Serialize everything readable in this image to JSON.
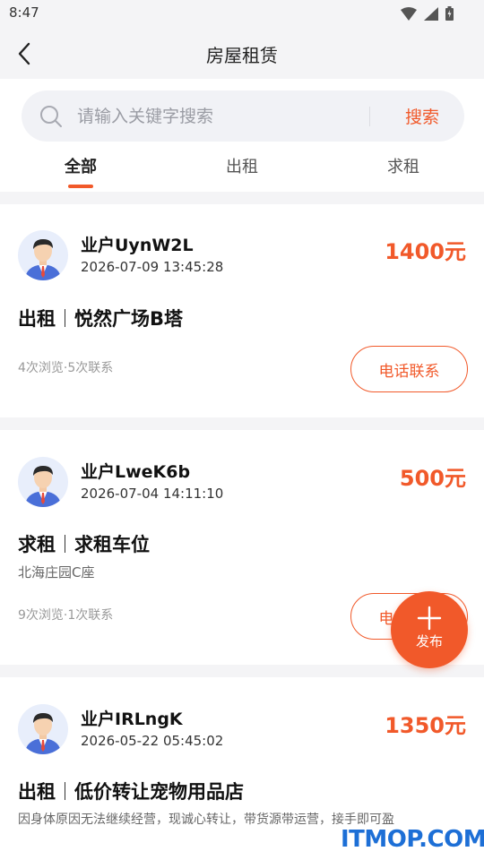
{
  "status_bar": {
    "time": "8:47",
    "icons": [
      "wifi-icon",
      "signal-icon",
      "battery-icon"
    ]
  },
  "header": {
    "title": "房屋租赁",
    "back_icon": "chevron-left-icon"
  },
  "search": {
    "placeholder": "请输入关键字搜索",
    "value": "",
    "button_label": "搜索",
    "icon": "search-icon"
  },
  "tabs": [
    {
      "label": "全部",
      "active": true
    },
    {
      "label": "出租",
      "active": false
    },
    {
      "label": "求租",
      "active": false
    }
  ],
  "listings": [
    {
      "user": "业户UynW2L",
      "time": "2026-07-09 13:45:28",
      "price": "1400元",
      "type": "出租",
      "title": "悦然广场B塔",
      "address": "",
      "description": "",
      "stats": "4次浏览·5次联系",
      "contact_label": "电话联系"
    },
    {
      "user": "业户LweK6b",
      "time": "2026-07-04 14:11:10",
      "price": "500元",
      "type": "求租",
      "title": "求租车位",
      "address": "北海庄园C座",
      "description": "",
      "stats": "9次浏览·1次联系",
      "contact_label": "电话联系"
    },
    {
      "user": "业户IRLngK",
      "time": "2026-05-22 05:45:02",
      "price": "1350元",
      "type": "出租",
      "title": "低价转让宠物用品店",
      "address": "",
      "description": "因身体原因无法继续经营，现诚心转让，带货源带运营，接手即可盈",
      "stats": "",
      "contact_label": ""
    }
  ],
  "fab": {
    "label": "发布",
    "icon": "plus-icon"
  },
  "watermark": "ITMOP.COM",
  "colors": {
    "accent": "#f1592a",
    "background": "#f4f4f6",
    "watermark": "#1d6fd6"
  }
}
